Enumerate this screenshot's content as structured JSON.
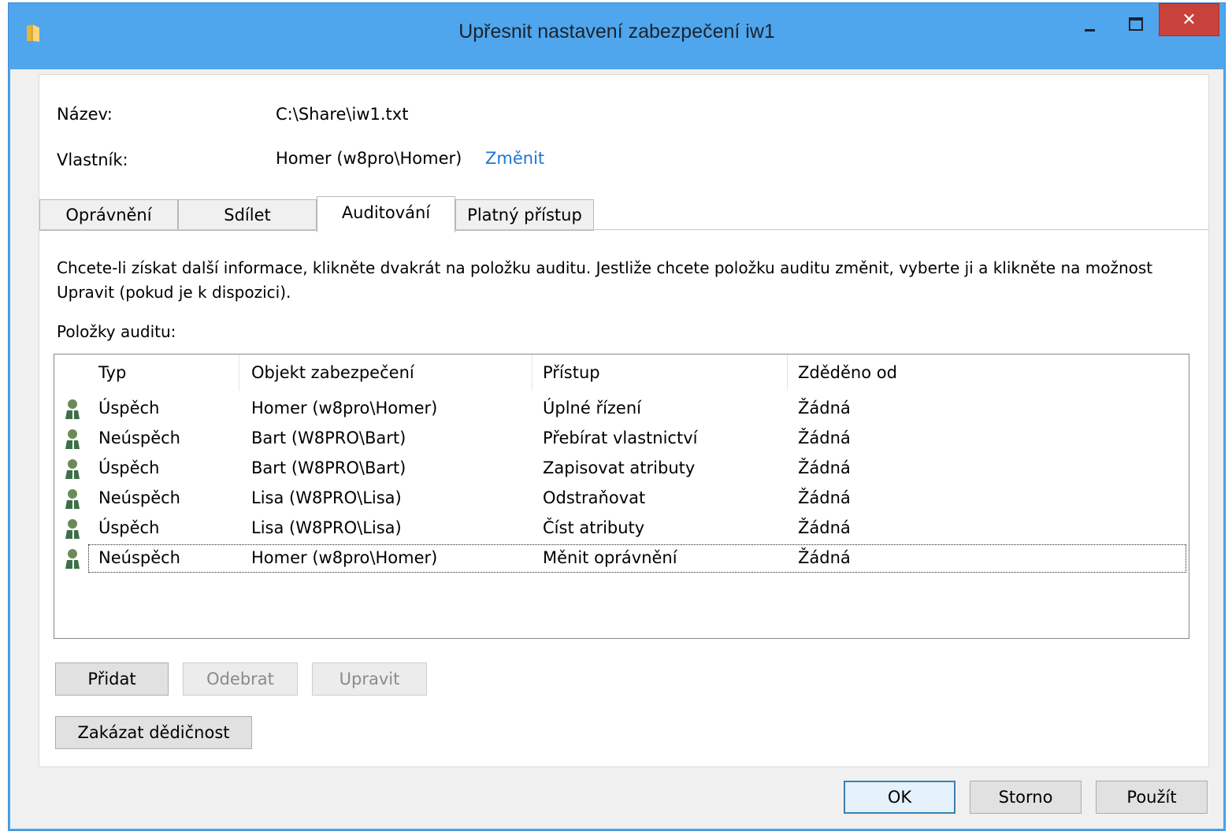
{
  "window": {
    "title": "Upřesnit nastavení zabezpečení iw1",
    "close_glyph": "✕"
  },
  "info_fields": {
    "name_label": "Název:",
    "name_value": "C:\\Share\\iw1.txt",
    "owner_label": "Vlastník:",
    "owner_value": "Homer (w8pro\\Homer)",
    "owner_change_link": "Změnit"
  },
  "tabs": [
    {
      "label": "Oprávnění",
      "active": false
    },
    {
      "label": "Sdílet",
      "active": false
    },
    {
      "label": "Auditování",
      "active": true
    },
    {
      "label": "Platný přístup",
      "active": false
    }
  ],
  "auditing": {
    "description": "Chcete-li získat další informace, klikněte dvakrát na položku auditu. Jestliže chcete položku auditu změnit, vyberte ji a klikněte na možnost Upravit (pokud je k dispozici).",
    "list_label": "Položky auditu:",
    "columns": [
      "Typ",
      "Objekt zabezpečení",
      "Přístup",
      "Zděděno od"
    ],
    "rows": [
      {
        "type": "Úspěch",
        "principal": "Homer (w8pro\\Homer)",
        "access": "Úplné řízení",
        "inherited": "Žádná"
      },
      {
        "type": "Neúspěch",
        "principal": "Bart (W8PRO\\Bart)",
        "access": "Přebírat vlastnictví",
        "inherited": "Žádná"
      },
      {
        "type": "Úspěch",
        "principal": "Bart (W8PRO\\Bart)",
        "access": "Zapisovat atributy",
        "inherited": "Žádná"
      },
      {
        "type": "Neúspěch",
        "principal": "Lisa (W8PRO\\Lisa)",
        "access": "Odstraňovat",
        "inherited": "Žádná"
      },
      {
        "type": "Úspěch",
        "principal": "Lisa (W8PRO\\Lisa)",
        "access": "Číst atributy",
        "inherited": "Žádná"
      },
      {
        "type": "Neúspěch",
        "principal": "Homer (w8pro\\Homer)",
        "access": "Měnit oprávnění",
        "inherited": "Žádná"
      }
    ],
    "buttons": {
      "add": "Přidat",
      "remove": "Odebrat",
      "edit": "Upravit",
      "disable_inheritance": "Zakázat dědičnost"
    }
  },
  "footer": {
    "ok": "OK",
    "cancel": "Storno",
    "apply": "Použít"
  },
  "colors": {
    "title_bar": "#4fa6ec",
    "close_button": "#c8413a",
    "link": "#1e74d6"
  }
}
